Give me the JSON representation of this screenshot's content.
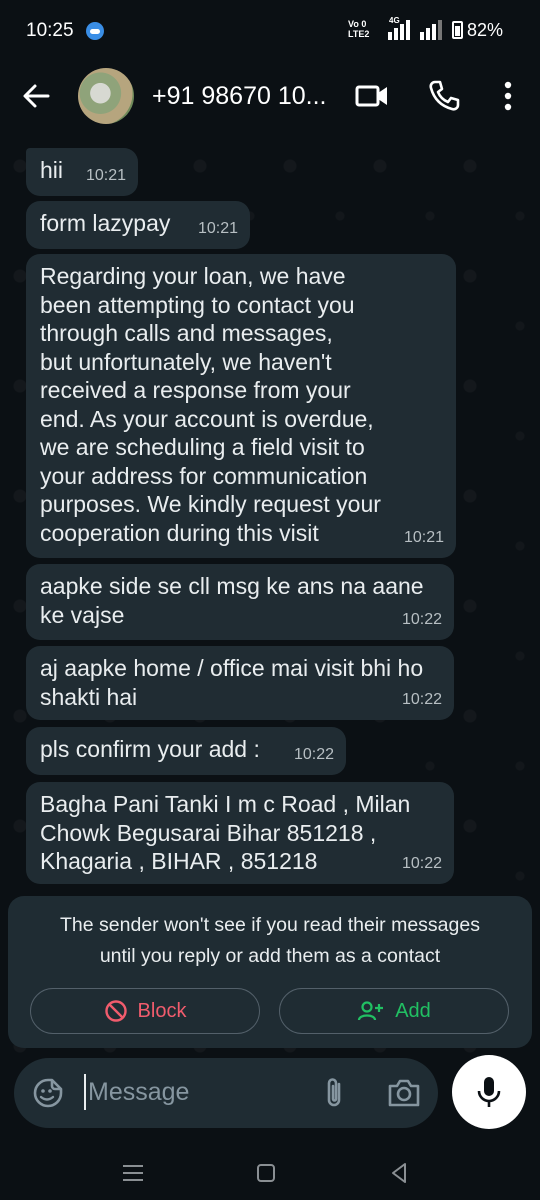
{
  "status_bar": {
    "time": "10:25",
    "volte": "Vo 0\nLTE2",
    "network": "4G",
    "battery": "82%"
  },
  "header": {
    "contact": "+91 98670 10...",
    "icons": [
      "back-arrow-icon",
      "video-call-icon",
      "phone-icon",
      "more-vert-icon"
    ]
  },
  "messages": [
    {
      "text": "hii",
      "time": "10:21"
    },
    {
      "text": "form lazypay",
      "time": "10:21"
    },
    {
      "text": "Regarding your loan, we have\nbeen attempting to contact you\nthrough calls and messages,\nbut unfortunately, we haven't\nreceived a response from your\nend. As your account is overdue,\nwe are scheduling a field visit to\nyour address for communication\npurposes.  We kindly request your\ncooperation during this visit",
      "time": "10:21"
    },
    {
      "text": "aapke side se cll msg ke ans na aane\nke vajse",
      "time": "10:22"
    },
    {
      "text": "aj aapke home / office mai visit bhi ho\nshakti hai",
      "time": "10:22"
    },
    {
      "text": "pls confirm your add :",
      "time": "10:22"
    },
    {
      "text": "Bagha Pani Tanki I m c Road , Milan\nChowk Begusarai Bihar 851218 ,\nKhagaria , BIHAR , 851218",
      "time": "10:22"
    }
  ],
  "unknown_card": {
    "text": "The sender won't see if you read their messages\nuntil you reply or add them as a contact",
    "block_label": "Block",
    "add_label": "Add"
  },
  "composer": {
    "placeholder": "Message"
  },
  "colors": {
    "background": "#0b1014",
    "bubble": "#202c33",
    "block": "#f15c6d",
    "add": "#21c063"
  }
}
